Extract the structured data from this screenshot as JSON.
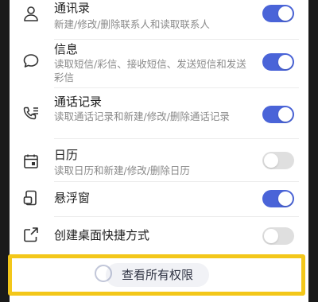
{
  "permissions": [
    {
      "title": "通讯录",
      "desc": "新建/修改/删除联系人和读取联系人",
      "enabled": true,
      "icon": "person-icon"
    },
    {
      "title": "信息",
      "desc": "读取短信/彩信、接收短信、发送短信和发送彩信",
      "enabled": true,
      "icon": "chat-bubble-icon"
    },
    {
      "title": "通话记录",
      "desc": "读取通话记录和新建/修改/删除通话记录",
      "enabled": true,
      "icon": "call-log-icon"
    },
    {
      "title": "日历",
      "desc": "读取日历和新建/修改/删除日历",
      "enabled": false,
      "icon": "calendar-icon"
    },
    {
      "title": "悬浮窗",
      "desc": "",
      "enabled": true,
      "icon": "floating-window-icon"
    },
    {
      "title": "创建桌面快捷方式",
      "desc": "",
      "enabled": false,
      "icon": "shortcut-icon"
    }
  ],
  "footer": {
    "view_all_label": "查看所有权限"
  },
  "colors": {
    "toggle_on": "#4a64d8",
    "toggle_off": "#dfdfdf",
    "highlight": "#f3c71a"
  }
}
